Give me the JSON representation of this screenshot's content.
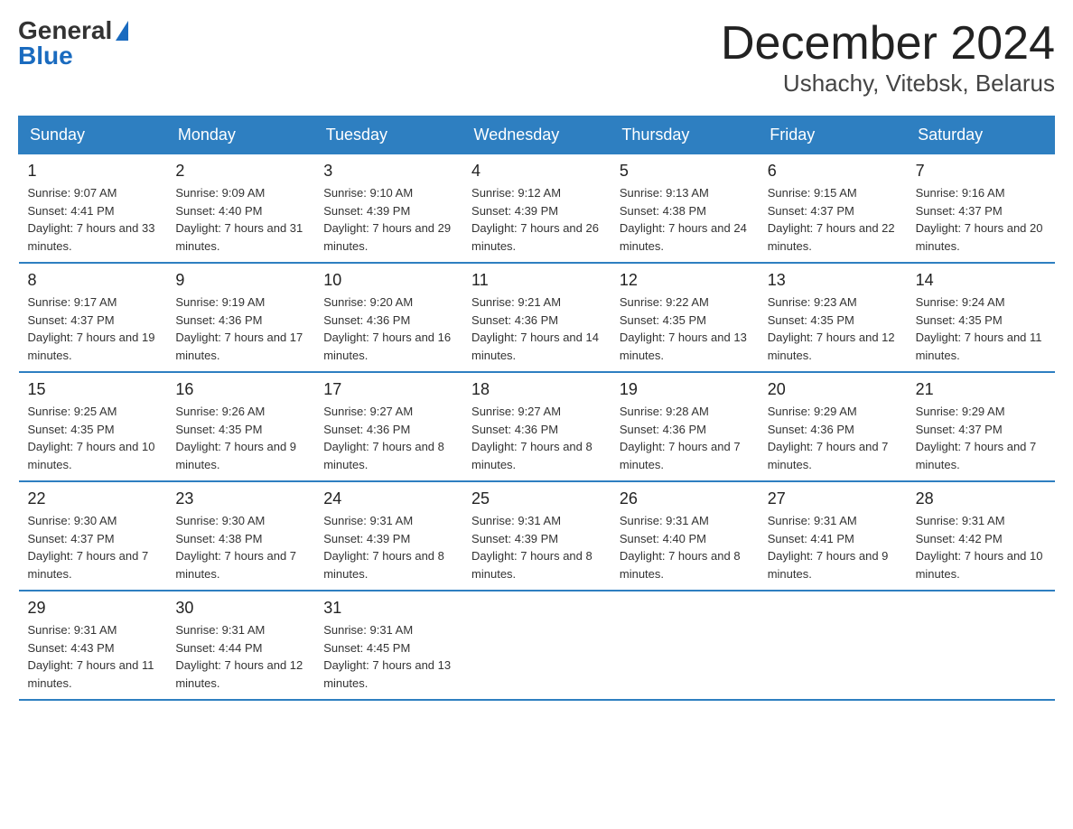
{
  "logo": {
    "general": "General",
    "blue": "Blue"
  },
  "title": "December 2024",
  "subtitle": "Ushachy, Vitebsk, Belarus",
  "days_of_week": [
    "Sunday",
    "Monday",
    "Tuesday",
    "Wednesday",
    "Thursday",
    "Friday",
    "Saturday"
  ],
  "weeks": [
    [
      {
        "day": "1",
        "sunrise": "9:07 AM",
        "sunset": "4:41 PM",
        "daylight": "7 hours and 33 minutes."
      },
      {
        "day": "2",
        "sunrise": "9:09 AM",
        "sunset": "4:40 PM",
        "daylight": "7 hours and 31 minutes."
      },
      {
        "day": "3",
        "sunrise": "9:10 AM",
        "sunset": "4:39 PM",
        "daylight": "7 hours and 29 minutes."
      },
      {
        "day": "4",
        "sunrise": "9:12 AM",
        "sunset": "4:39 PM",
        "daylight": "7 hours and 26 minutes."
      },
      {
        "day": "5",
        "sunrise": "9:13 AM",
        "sunset": "4:38 PM",
        "daylight": "7 hours and 24 minutes."
      },
      {
        "day": "6",
        "sunrise": "9:15 AM",
        "sunset": "4:37 PM",
        "daylight": "7 hours and 22 minutes."
      },
      {
        "day": "7",
        "sunrise": "9:16 AM",
        "sunset": "4:37 PM",
        "daylight": "7 hours and 20 minutes."
      }
    ],
    [
      {
        "day": "8",
        "sunrise": "9:17 AM",
        "sunset": "4:37 PM",
        "daylight": "7 hours and 19 minutes."
      },
      {
        "day": "9",
        "sunrise": "9:19 AM",
        "sunset": "4:36 PM",
        "daylight": "7 hours and 17 minutes."
      },
      {
        "day": "10",
        "sunrise": "9:20 AM",
        "sunset": "4:36 PM",
        "daylight": "7 hours and 16 minutes."
      },
      {
        "day": "11",
        "sunrise": "9:21 AM",
        "sunset": "4:36 PM",
        "daylight": "7 hours and 14 minutes."
      },
      {
        "day": "12",
        "sunrise": "9:22 AM",
        "sunset": "4:35 PM",
        "daylight": "7 hours and 13 minutes."
      },
      {
        "day": "13",
        "sunrise": "9:23 AM",
        "sunset": "4:35 PM",
        "daylight": "7 hours and 12 minutes."
      },
      {
        "day": "14",
        "sunrise": "9:24 AM",
        "sunset": "4:35 PM",
        "daylight": "7 hours and 11 minutes."
      }
    ],
    [
      {
        "day": "15",
        "sunrise": "9:25 AM",
        "sunset": "4:35 PM",
        "daylight": "7 hours and 10 minutes."
      },
      {
        "day": "16",
        "sunrise": "9:26 AM",
        "sunset": "4:35 PM",
        "daylight": "7 hours and 9 minutes."
      },
      {
        "day": "17",
        "sunrise": "9:27 AM",
        "sunset": "4:36 PM",
        "daylight": "7 hours and 8 minutes."
      },
      {
        "day": "18",
        "sunrise": "9:27 AM",
        "sunset": "4:36 PM",
        "daylight": "7 hours and 8 minutes."
      },
      {
        "day": "19",
        "sunrise": "9:28 AM",
        "sunset": "4:36 PM",
        "daylight": "7 hours and 7 minutes."
      },
      {
        "day": "20",
        "sunrise": "9:29 AM",
        "sunset": "4:36 PM",
        "daylight": "7 hours and 7 minutes."
      },
      {
        "day": "21",
        "sunrise": "9:29 AM",
        "sunset": "4:37 PM",
        "daylight": "7 hours and 7 minutes."
      }
    ],
    [
      {
        "day": "22",
        "sunrise": "9:30 AM",
        "sunset": "4:37 PM",
        "daylight": "7 hours and 7 minutes."
      },
      {
        "day": "23",
        "sunrise": "9:30 AM",
        "sunset": "4:38 PM",
        "daylight": "7 hours and 7 minutes."
      },
      {
        "day": "24",
        "sunrise": "9:31 AM",
        "sunset": "4:39 PM",
        "daylight": "7 hours and 8 minutes."
      },
      {
        "day": "25",
        "sunrise": "9:31 AM",
        "sunset": "4:39 PM",
        "daylight": "7 hours and 8 minutes."
      },
      {
        "day": "26",
        "sunrise": "9:31 AM",
        "sunset": "4:40 PM",
        "daylight": "7 hours and 8 minutes."
      },
      {
        "day": "27",
        "sunrise": "9:31 AM",
        "sunset": "4:41 PM",
        "daylight": "7 hours and 9 minutes."
      },
      {
        "day": "28",
        "sunrise": "9:31 AM",
        "sunset": "4:42 PM",
        "daylight": "7 hours and 10 minutes."
      }
    ],
    [
      {
        "day": "29",
        "sunrise": "9:31 AM",
        "sunset": "4:43 PM",
        "daylight": "7 hours and 11 minutes."
      },
      {
        "day": "30",
        "sunrise": "9:31 AM",
        "sunset": "4:44 PM",
        "daylight": "7 hours and 12 minutes."
      },
      {
        "day": "31",
        "sunrise": "9:31 AM",
        "sunset": "4:45 PM",
        "daylight": "7 hours and 13 minutes."
      },
      null,
      null,
      null,
      null
    ]
  ]
}
